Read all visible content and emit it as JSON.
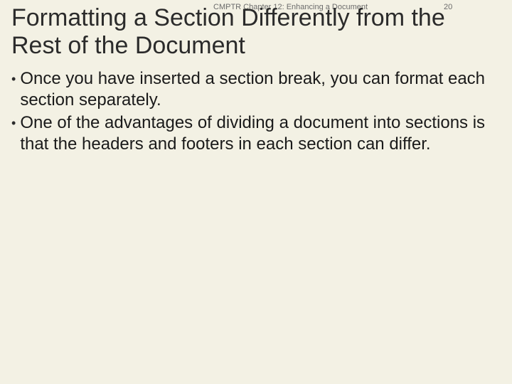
{
  "header": {
    "chapter": "CMPTR Chapter 12: Enhancing a Document",
    "page": "20"
  },
  "title": "Formatting a Section Differently from the Rest of the Document",
  "bullets": [
    "Once you have inserted a section break, you can format each section separately.",
    "One of the advantages of dividing a document into sections is that the headers and footers in each section can differ."
  ]
}
